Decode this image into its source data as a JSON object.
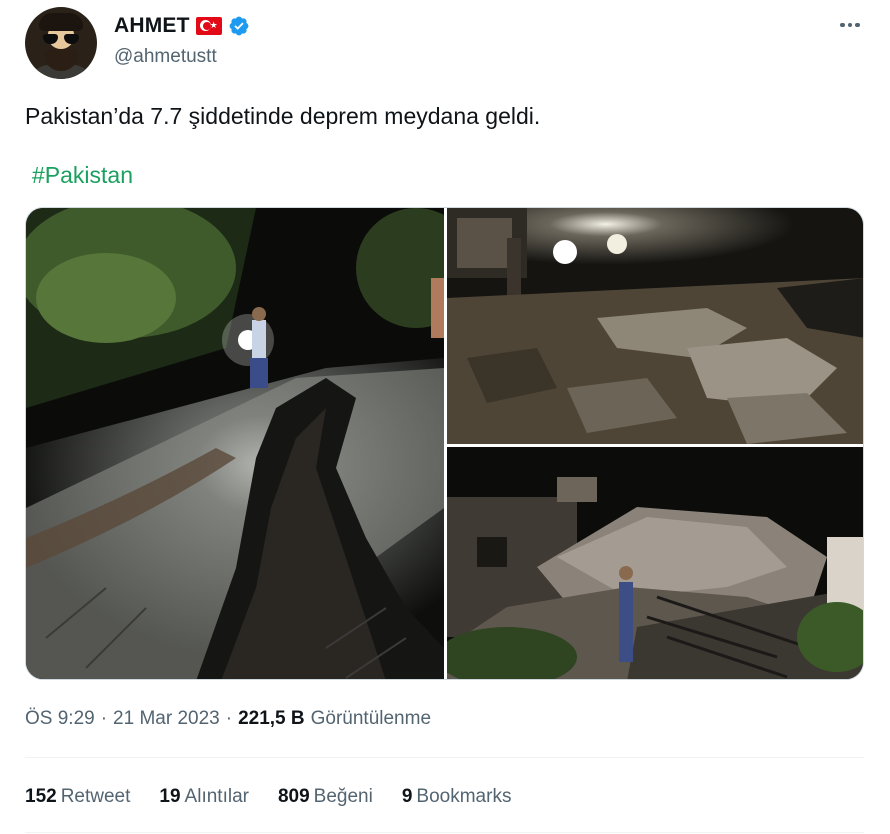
{
  "user": {
    "display_name": "AHMET",
    "handle": "@ahmetustt",
    "flag": "turkey-flag",
    "verified": true
  },
  "tweet": {
    "text": "Pakistan’da 7.7 şiddetinde deprem meydana geldi.",
    "hashtag": "#Pakistan",
    "photos": [
      {
        "description_icon": "photo-cracked-road"
      },
      {
        "description_icon": "photo-rubble-street"
      },
      {
        "description_icon": "photo-collapsed-building"
      }
    ]
  },
  "meta": {
    "time": "ÖS 9:29",
    "sep1": "·",
    "date": "21 Mar 2023",
    "sep2": "·",
    "views_count": "221,5 B",
    "views_label": "Görüntülenme"
  },
  "stats": {
    "retweets_count": "152",
    "retweets_label": "Retweet",
    "quotes_count": "19",
    "quotes_label": "Alıntılar",
    "likes_count": "809",
    "likes_label": "Beğeni",
    "bookmarks_count": "9",
    "bookmarks_label": "Bookmarks"
  },
  "colors": {
    "hashtag": "#1aa15f",
    "verified": "#1d9bf0",
    "secondary_text": "#536471",
    "flag_red": "#e30a17"
  }
}
